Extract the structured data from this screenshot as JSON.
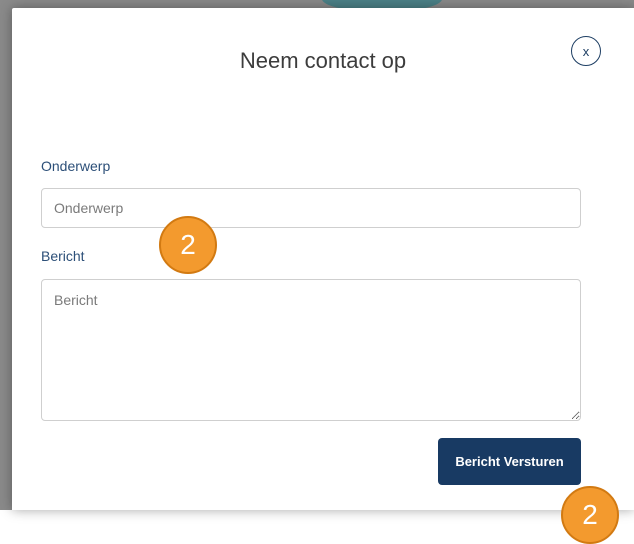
{
  "modal": {
    "title": "Neem contact op",
    "close_label": "x"
  },
  "form": {
    "subject": {
      "label": "Onderwerp",
      "placeholder": "Onderwerp",
      "value": ""
    },
    "message": {
      "label": "Bericht",
      "placeholder": "Bericht",
      "value": ""
    },
    "submit_label": "Bericht Versturen"
  },
  "annotations": {
    "step_1": "2",
    "step_2": "2"
  },
  "colors": {
    "primary": "#183a63",
    "label": "#2c4f78",
    "badge": "#f39a2e",
    "backdrop": "#8a8a8a"
  }
}
